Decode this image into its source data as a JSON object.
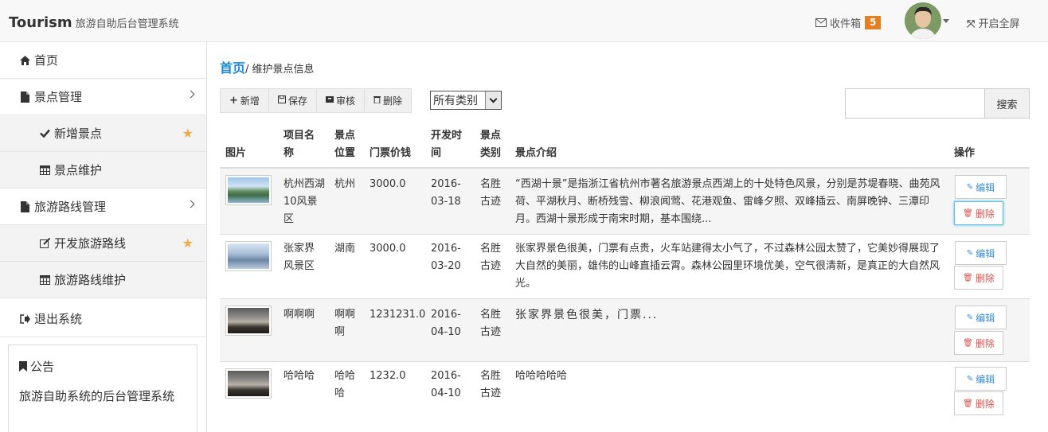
{
  "header": {
    "brand": "Tourism",
    "subtitle": "旅游自助后台管理系统",
    "inbox_label": "收件箱",
    "inbox_count": "5",
    "fullscreen_label": "开启全屏"
  },
  "sidebar": {
    "items": [
      {
        "label": "首页",
        "icon": "home-icon"
      },
      {
        "label": "景点管理",
        "icon": "file-icon"
      },
      {
        "label": "新增景点",
        "icon": "check-icon"
      },
      {
        "label": "景点维护",
        "icon": "calendar-icon"
      },
      {
        "label": "旅游路线管理",
        "icon": "file-icon"
      },
      {
        "label": "开发旅游路线",
        "icon": "edit-icon"
      },
      {
        "label": "旅游路线维护",
        "icon": "calendar-icon"
      },
      {
        "label": "退出系统",
        "icon": "sign-out-icon"
      }
    ],
    "notice": {
      "title": "公告",
      "body": "旅游自助系统的后台管理系统"
    }
  },
  "breadcrumb": {
    "home": "首页",
    "separator": "/",
    "current": "维护景点信息"
  },
  "toolbar": {
    "add": "新增",
    "save": "保存",
    "review": "审核",
    "delete": "删除"
  },
  "filter": {
    "selected": "所有类别"
  },
  "search": {
    "button": "搜索",
    "value": ""
  },
  "table": {
    "headers": {
      "image": "图片",
      "name": "项目名称",
      "location": "景点位置",
      "price": "门票价钱",
      "date": "开发时间",
      "category": "景点类别",
      "intro": "景点介绍",
      "ops": "操作"
    },
    "rows": [
      {
        "name": "杭州西湖10风景区",
        "location": "杭州",
        "price": "3000.0",
        "date": "2016-03-18",
        "category": "名胜古迹",
        "intro": "“西湖十景”是指浙江省杭州市著名旅游景点西湖上的十处特色风景，分别是苏堤春晓、曲苑风荷、平湖秋月、断桥残雪、柳浪闻莺、花港观鱼、雷峰夕照、双峰插云、南屏晚钟、三潭印月。西湖十景形成于南宋时期，基本围绕..."
      },
      {
        "name": "张家界风景区",
        "location": "湖南",
        "price": "3000.0",
        "date": "2016-03-20",
        "category": "名胜古迹",
        "intro": "张家界景色很美，门票有点贵，火车站建得太小气了，不过森林公园太赞了，它美妙得展现了大自然的美丽，雄伟的山峰直插云霄。森林公园里环境优美，空气很清新，是真正的大自然风光。"
      },
      {
        "name": "啊啊啊",
        "location": "啊啊啊",
        "price": "1231231.0",
        "date": "2016-04-10",
        "category": "名胜古迹",
        "intro": "张家界景色很美，门票..."
      },
      {
        "name": "哈哈哈",
        "location": "哈哈哈",
        "price": "1232.0",
        "date": "2016-04-10",
        "category": "名胜古迹",
        "intro": "哈哈哈哈哈"
      }
    ],
    "edit_label": "编辑",
    "delete_label": "删除"
  },
  "colors": {
    "accent": "#1a8ad4",
    "badge": "#e67e22",
    "star": "#f0ad4e",
    "danger": "#d9534f"
  }
}
